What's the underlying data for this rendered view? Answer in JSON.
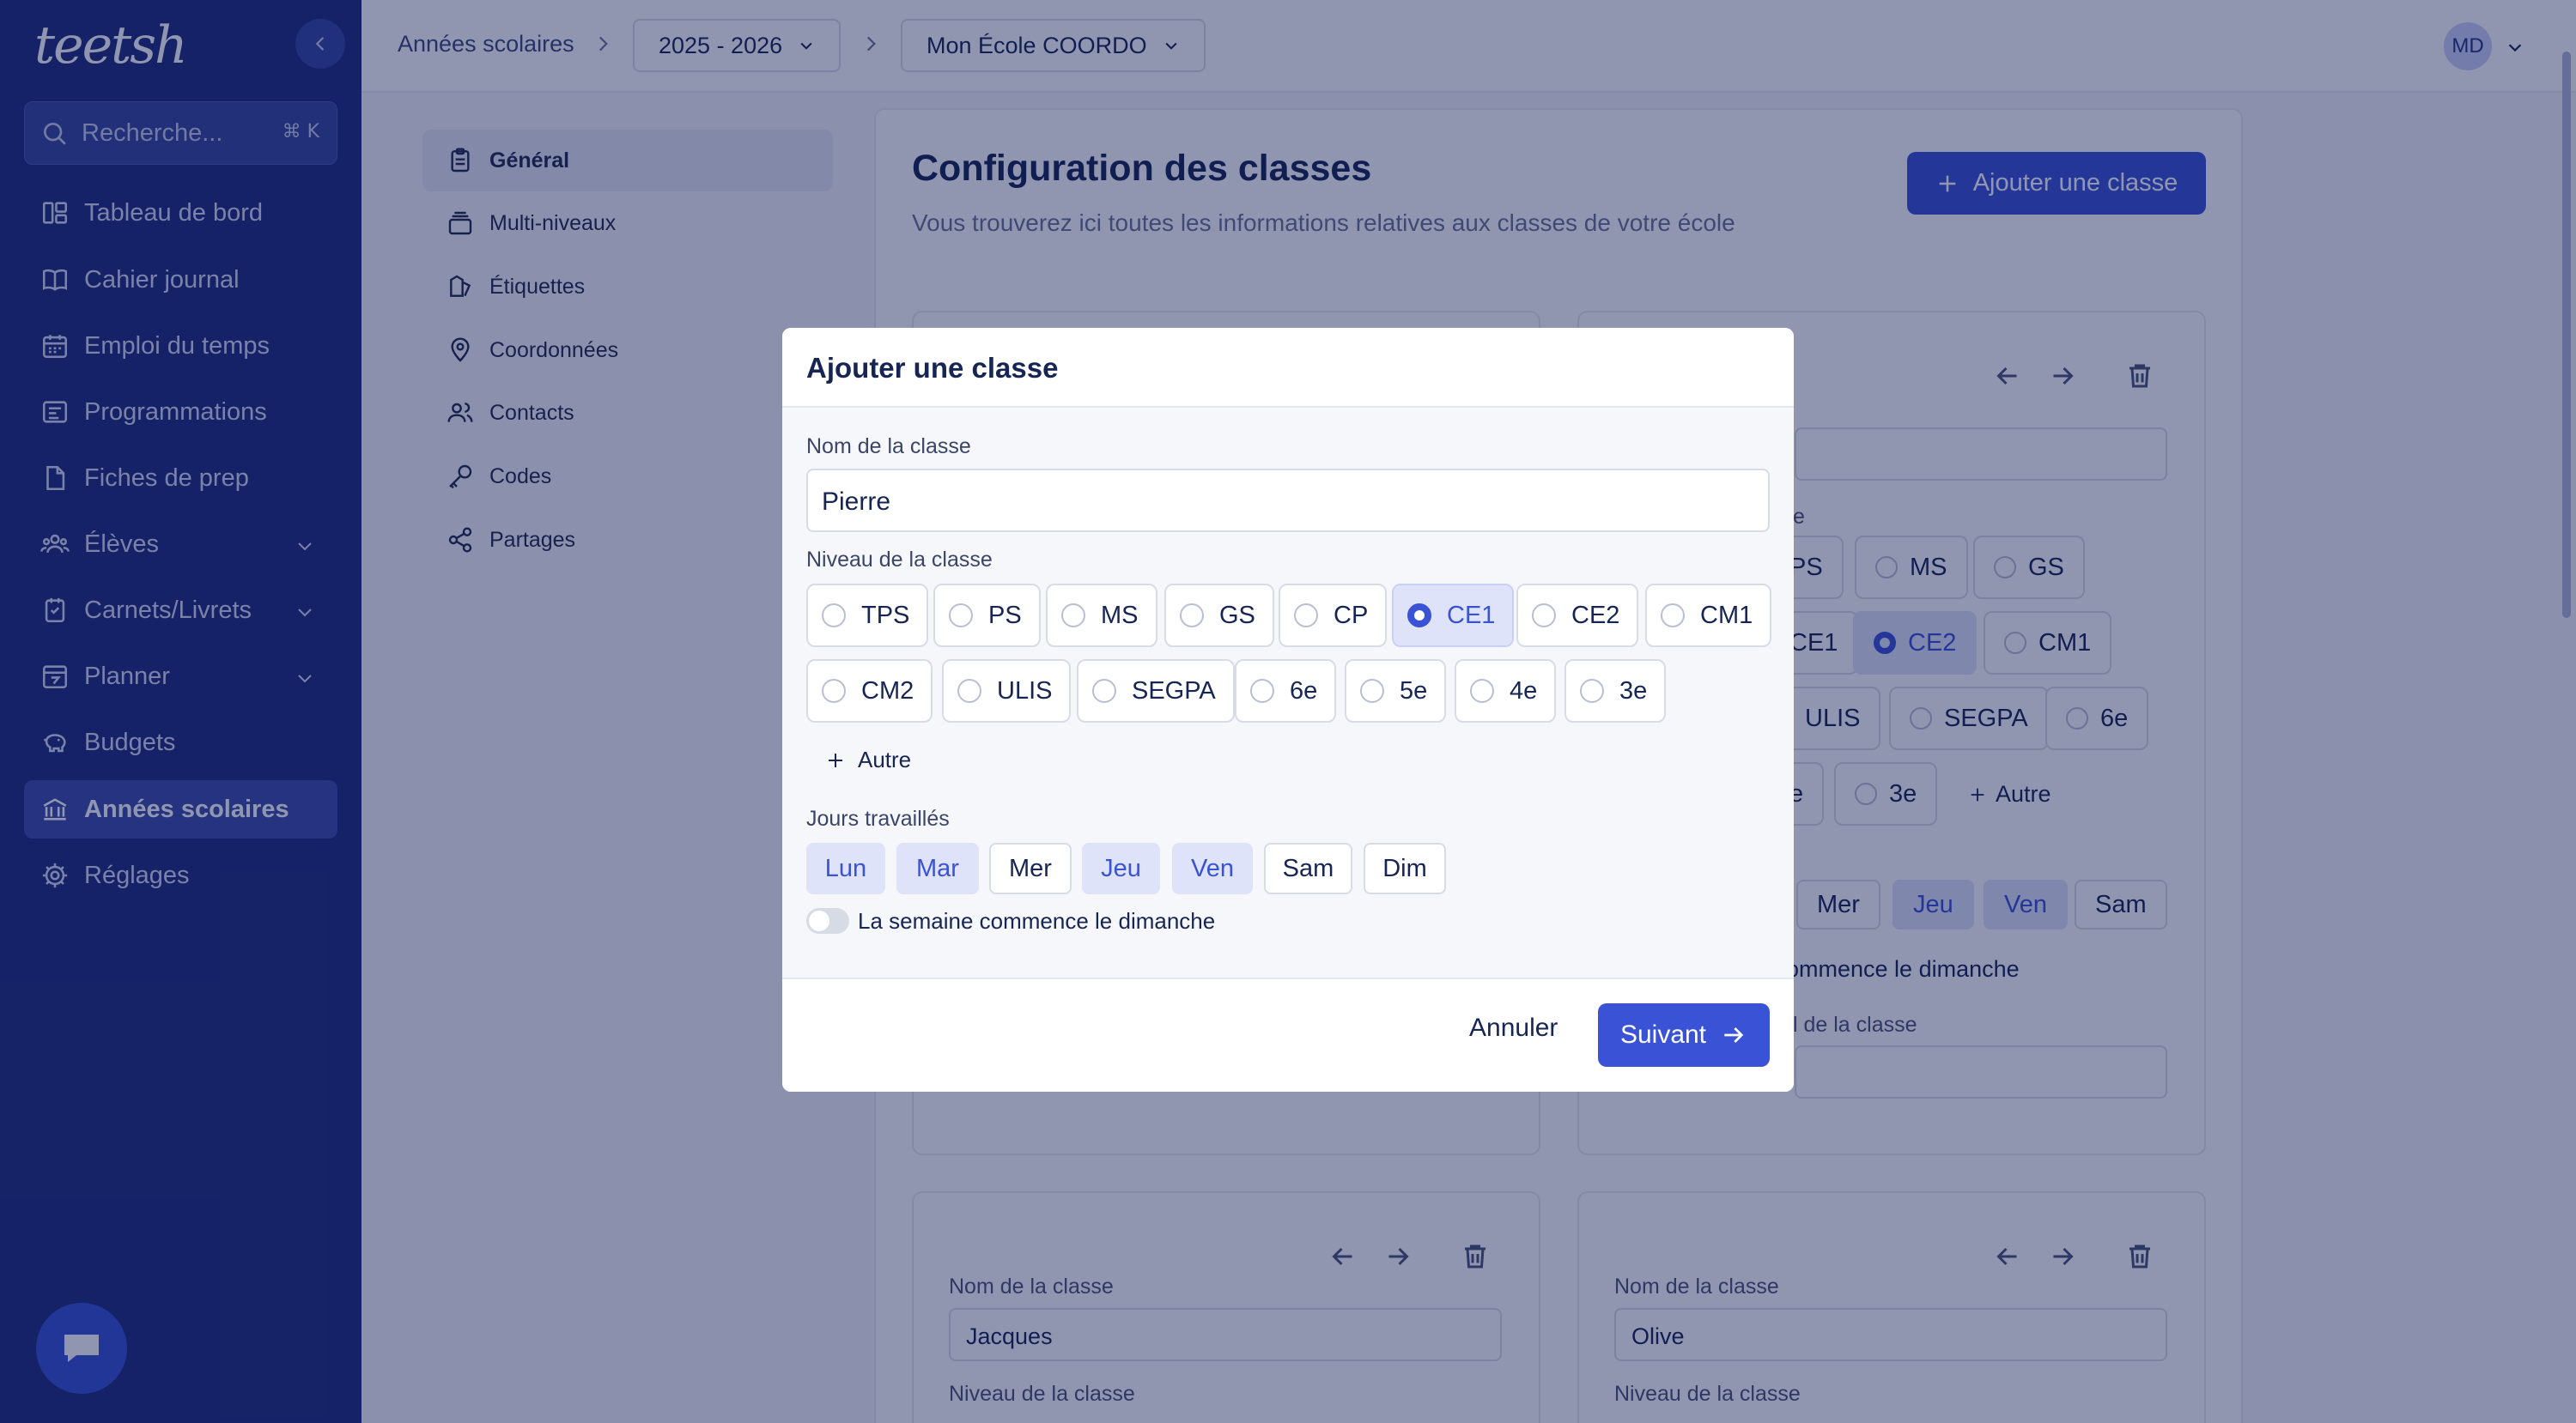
{
  "sidebar": {
    "logo": "teetsh",
    "search_placeholder": "Recherche...",
    "search_shortcut": "⌘ K",
    "items": [
      {
        "label": "Tableau de bord",
        "icon": "dashboard-icon"
      },
      {
        "label": "Cahier journal",
        "icon": "book-icon"
      },
      {
        "label": "Emploi du temps",
        "icon": "calendar-icon"
      },
      {
        "label": "Programmations",
        "icon": "programming-icon"
      },
      {
        "label": "Fiches de prep",
        "icon": "file-icon"
      },
      {
        "label": "Élèves",
        "icon": "students-icon"
      },
      {
        "label": "Carnets/Livrets",
        "icon": "notebook-icon"
      },
      {
        "label": "Planner",
        "icon": "planner-icon"
      },
      {
        "label": "Budgets",
        "icon": "piggy-bank-icon"
      },
      {
        "label": "Années scolaires",
        "icon": "school-icon"
      },
      {
        "label": "Réglages",
        "icon": "gear-icon"
      }
    ],
    "active_item": "Années scolaires"
  },
  "topbar": {
    "breadcrumb_root": "Années scolaires",
    "year": "2025 - 2026",
    "school": "Mon École COORDO",
    "user_initials": "MD"
  },
  "settings_nav": [
    {
      "label": "Général",
      "icon": "clipboard-icon"
    },
    {
      "label": "Multi-niveaux",
      "icon": "layers-icon"
    },
    {
      "label": "Étiquettes",
      "icon": "tag-icon"
    },
    {
      "label": "Coordonnées",
      "icon": "location-icon"
    },
    {
      "label": "Contacts",
      "icon": "users-icon"
    },
    {
      "label": "Codes",
      "icon": "key-icon"
    },
    {
      "label": "Partages",
      "icon": "share-icon"
    }
  ],
  "main": {
    "title": "Configuration des classes",
    "subtitle": "Vous trouverez ici toutes les informations relatives aux classes de votre école",
    "add_button": "Ajouter une classe"
  },
  "background_cards": {
    "label_fragment": "e",
    "levels_row1": [
      "PS",
      "MS",
      "GS"
    ],
    "levels_row2": [
      "CE1",
      "CE2",
      "CM1"
    ],
    "levels_row3": [
      "ULIS",
      "SEGPA",
      "6e"
    ],
    "levels_row4": [
      "e",
      "3e"
    ],
    "selected_level": "CE2",
    "autre": "Autre",
    "days": [
      "Mer",
      "Jeu",
      "Ven",
      "Sam"
    ],
    "days_on": [
      "Jeu",
      "Ven"
    ],
    "toggle_fragment": "ommence le dimanche",
    "name_fragment": "l de la classe",
    "card3_name_label": "Nom de la classe",
    "card3_name_value": "Jacques",
    "card3_level_label": "Niveau de la classe",
    "card4_name_label": "Nom de la classe",
    "card4_name_value": "Olive",
    "card4_level_label": "Niveau de la classe"
  },
  "modal": {
    "title": "Ajouter une classe",
    "name_label": "Nom de la classe",
    "name_value": "Pierre",
    "level_label": "Niveau de la classe",
    "levels": [
      "TPS",
      "PS",
      "MS",
      "GS",
      "CP",
      "CE1",
      "CE2",
      "CM1",
      "CM2",
      "ULIS",
      "SEGPA",
      "6e",
      "5e",
      "4e",
      "3e"
    ],
    "selected_level": "CE1",
    "other_button": "Autre",
    "days_label": "Jours travaillés",
    "days": [
      "Lun",
      "Mar",
      "Mer",
      "Jeu",
      "Ven",
      "Sam",
      "Dim"
    ],
    "days_on": [
      "Lun",
      "Mar",
      "Jeu",
      "Ven"
    ],
    "sunday_toggle_label": "La semaine commence le dimanche",
    "sunday_toggle_on": false,
    "cancel": "Annuler",
    "next": "Suivant"
  },
  "colors": {
    "sidebar": "#1f2d7a",
    "accent": "#3a52d6",
    "selected_bg": "#dfe3f9",
    "overlay": "rgba(12,22,80,0.45)"
  }
}
